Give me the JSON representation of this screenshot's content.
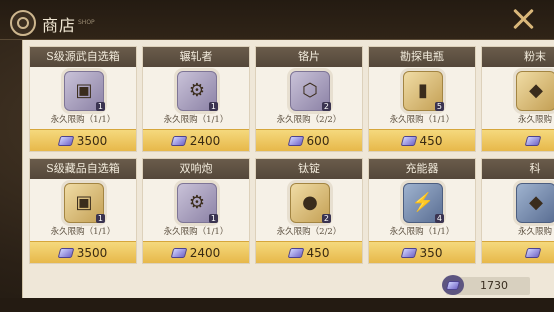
{
  "header": {
    "title": "商店",
    "subtitle": "SHOP"
  },
  "shop": {
    "rows": [
      [
        {
          "name": "S级源武自选箱",
          "limit": "永久限购（1/1）",
          "price": "3500",
          "qty": "1",
          "icon": "chest-icon"
        },
        {
          "name": "辗轧者",
          "limit": "永久限购（1/1）",
          "price": "2400",
          "qty": "1",
          "icon": "cannon-icon"
        },
        {
          "name": "铬片",
          "limit": "永久限购（2/2）",
          "price": "600",
          "qty": "2",
          "icon": "chrome-plate-icon"
        },
        {
          "name": "勘探电瓶",
          "limit": "永久限购（1/1）",
          "price": "450",
          "qty": "5",
          "icon": "battery-icon"
        },
        {
          "name": "粉末",
          "limit": "永久限购",
          "price": "",
          "qty": "",
          "icon": "powder-icon"
        }
      ],
      [
        {
          "name": "S级藏品自选箱",
          "limit": "永久限购（1/1）",
          "price": "3500",
          "qty": "1",
          "icon": "golden-chest-icon"
        },
        {
          "name": "双响炮",
          "limit": "永久限购（1/1）",
          "price": "2400",
          "qty": "1",
          "icon": "double-cannon-icon"
        },
        {
          "name": "钛锭",
          "limit": "永久限购（2/2）",
          "price": "450",
          "qty": "2",
          "icon": "titanium-ingot-icon"
        },
        {
          "name": "充能器",
          "limit": "永久限购（1/1）",
          "price": "350",
          "qty": "4",
          "icon": "charger-icon"
        },
        {
          "name": "科",
          "limit": "永久限购",
          "price": "",
          "qty": "",
          "icon": "material-icon"
        }
      ]
    ]
  },
  "currency": {
    "amount": "1730",
    "icon": "gem-icon"
  }
}
